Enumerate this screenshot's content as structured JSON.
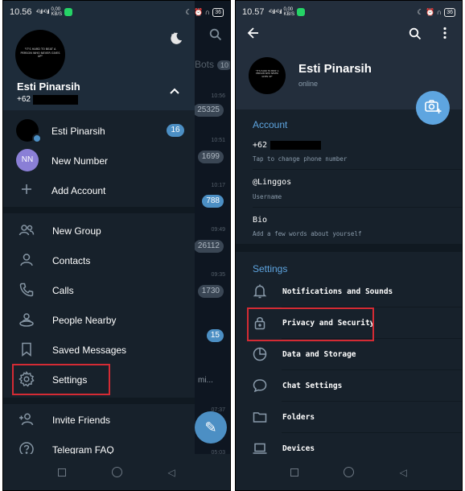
{
  "left_phone": {
    "status": {
      "time": "10.56",
      "signal": "⁴ᴳ.ıll ⁴ᴳ.ıll",
      "speed": "0,00 KB/S",
      "icons": "☾ ⏰ ∩",
      "battery": "36"
    },
    "chat_background": {
      "tab_label": "Bots",
      "tab_count": "10",
      "times": [
        "10:56",
        "10:51",
        "10:17",
        "09:49",
        "09:35",
        "07:37",
        "05:03"
      ],
      "badges": [
        "25325",
        "1699",
        "788",
        "26112",
        "1730",
        "15"
      ],
      "snippet": "mi..."
    },
    "drawer": {
      "avatar_text": "\"IT'S HARD TO BEAT A PERSON WHO NEVER GIVES UP\"",
      "avatar_signature": "Babe Ruth",
      "name": "Esti Pinarsih",
      "phone_prefix": "+62",
      "accounts": [
        {
          "label": "Esti Pinarsih",
          "badge": "16"
        },
        {
          "label": "New Number",
          "initials": "NN"
        },
        {
          "label": "Add Account"
        }
      ],
      "menu": [
        {
          "label": "New Group",
          "icon": "group-icon"
        },
        {
          "label": "Contacts",
          "icon": "person-icon"
        },
        {
          "label": "Calls",
          "icon": "phone-icon"
        },
        {
          "label": "People Nearby",
          "icon": "nearby-icon"
        },
        {
          "label": "Saved Messages",
          "icon": "bookmark-icon"
        },
        {
          "label": "Settings",
          "icon": "gear-icon"
        },
        {
          "label": "Invite Friends",
          "icon": "add-person-icon"
        },
        {
          "label": "Telegram FAQ",
          "icon": "question-icon"
        }
      ]
    }
  },
  "right_phone": {
    "status": {
      "time": "10.57",
      "signal": "⁴ᴳ.ıll ⁴ᴳ.ıll",
      "speed": "0,00 KB/S",
      "icons": "☾ ⏰ ∩",
      "battery": "36"
    },
    "profile": {
      "name": "Esti Pinarsih",
      "status": "online",
      "avatar_text": "\"IT'S HARD TO BEAT A PERSON WHO NEVER GIVES UP\""
    },
    "account": {
      "title": "Account",
      "phone_prefix": "+62",
      "phone_hint": "Tap to change phone number",
      "username": "@Linggos",
      "username_label": "Username",
      "bio": "Bio",
      "bio_hint": "Add a few words about yourself"
    },
    "settings": {
      "title": "Settings",
      "items": [
        {
          "label": "Notifications and Sounds",
          "icon": "bell-icon"
        },
        {
          "label": "Privacy and Security",
          "icon": "lock-icon"
        },
        {
          "label": "Data and Storage",
          "icon": "pie-chart-icon"
        },
        {
          "label": "Chat Settings",
          "icon": "chat-bubble-icon"
        },
        {
          "label": "Folders",
          "icon": "folder-icon"
        },
        {
          "label": "Devices",
          "icon": "laptop-icon"
        }
      ]
    }
  },
  "colors": {
    "accent": "#5ea5e0",
    "highlight": "#d42b34",
    "background": "#17212b"
  }
}
